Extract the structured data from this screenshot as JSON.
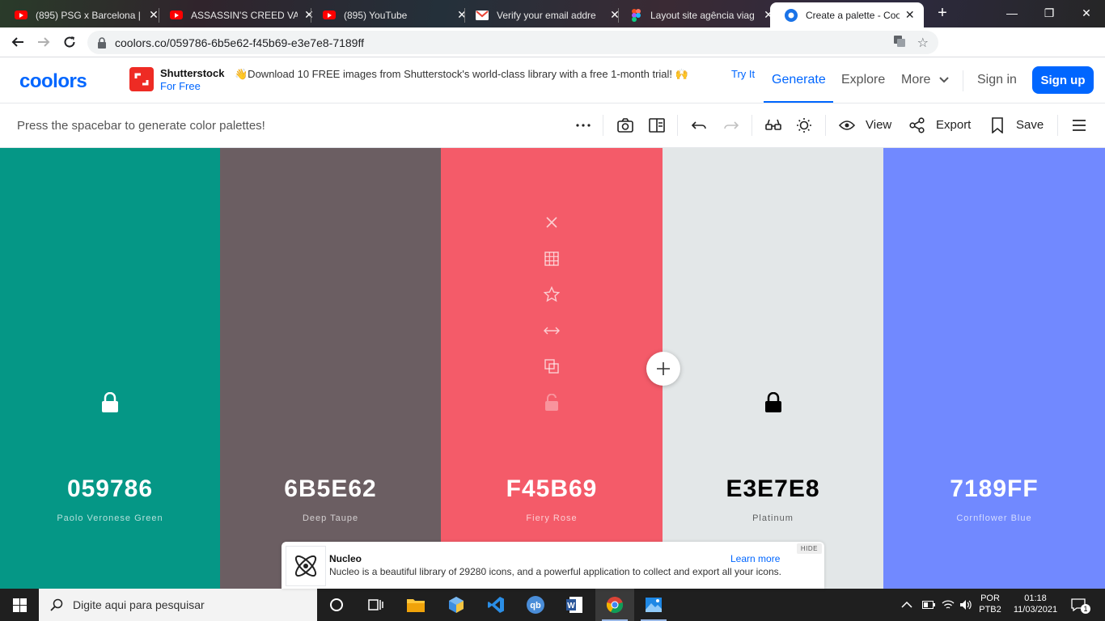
{
  "browser": {
    "tabs": [
      {
        "title": "(895) PSG x Barcelona |",
        "icon": "youtube-icon"
      },
      {
        "title": "ASSASSIN'S CREED VAL",
        "icon": "youtube-icon"
      },
      {
        "title": "(895) YouTube",
        "icon": "youtube-icon"
      },
      {
        "title": "Verify your email addre",
        "icon": "gmail-icon"
      },
      {
        "title": "Layout site agência viag",
        "icon": "figma-icon"
      },
      {
        "title": "Create a palette - Coolo",
        "icon": "coolors-icon",
        "active": true
      }
    ],
    "url": "coolors.co/059786-6b5e62-f45b69-e3e7e8-7189ff"
  },
  "header": {
    "logo": "coolors",
    "ad": {
      "brand": "Shutterstock",
      "brand_sub": "For Free",
      "text": "👋Download 10 FREE images from Shutterstock's world-class library with a free 1-month trial! 🙌",
      "cta": "Try It"
    },
    "nav": {
      "generate": "Generate",
      "explore": "Explore",
      "more": "More",
      "signin": "Sign in",
      "signup": "Sign up"
    }
  },
  "toolbar": {
    "hint": "Press the spacebar to generate color palettes!",
    "view": "View",
    "export": "Export",
    "save": "Save"
  },
  "palette": {
    "colors": [
      {
        "hex": "059786",
        "name": "Paolo Veronese Green",
        "color": "#059786",
        "text_theme": "light",
        "locked": true
      },
      {
        "hex": "6B5E62",
        "name": "Deep Taupe",
        "color": "#6B5E62",
        "text_theme": "light",
        "locked": false
      },
      {
        "hex": "F45B69",
        "name": "Fiery Rose",
        "color": "#F45B69",
        "text_theme": "light",
        "locked": false,
        "hovered": true
      },
      {
        "hex": "E3E7E8",
        "name": "Platinum",
        "color": "#E3E7E8",
        "text_theme": "dark",
        "locked": true
      },
      {
        "hex": "7189FF",
        "name": "Cornflower Blue",
        "color": "#7189FF",
        "text_theme": "light",
        "locked": false
      }
    ]
  },
  "adcard": {
    "title": "Nucleo",
    "description": "Nucleo is a beautiful library of 29280 icons, and a powerful application to collect and export all your icons.",
    "learn_more": "Learn more",
    "hide": "HIDE"
  },
  "taskbar": {
    "search_placeholder": "Digite aqui para pesquisar",
    "language": "POR",
    "layout": "PTB2",
    "time": "01:18",
    "date": "11/03/2021",
    "notifications": "1"
  }
}
